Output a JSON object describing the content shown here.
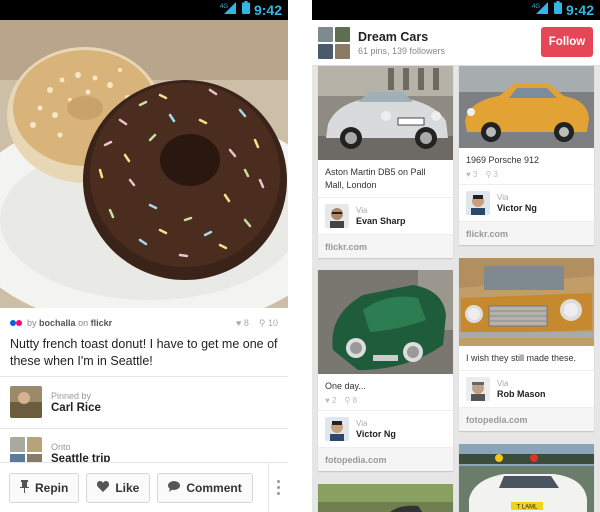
{
  "left": {
    "status": {
      "time": "9:42",
      "network": "4G"
    },
    "pin": {
      "by_prefix": "by",
      "user": "bochalla",
      "on_prefix": "on",
      "source": "flickr",
      "likes": "8",
      "repins": "10",
      "description": "Nutty french toast donut! I have to get me one of these when I'm in Seattle!"
    },
    "pinned_by": {
      "label": "Pinned by",
      "name": "Carl Rice"
    },
    "onto": {
      "label": "Onto",
      "name": "Seattle trip"
    },
    "actions": {
      "repin": "Repin",
      "like": "Like",
      "comment": "Comment"
    }
  },
  "right": {
    "status": {
      "time": "9:42",
      "network": "4G"
    },
    "board": {
      "title": "Dream Cars",
      "stats": "61 pins, 139 followers",
      "follow": "Follow"
    },
    "pins": {
      "aston": {
        "desc": "Aston Martin DB5 on Pall Mall, London",
        "via": "Via",
        "user": "Evan Sharp",
        "source": "flickr.com"
      },
      "porsche": {
        "desc": "1969 Porsche 912",
        "likes": "3",
        "repins": "3",
        "via": "Via",
        "user": "Victor Ng",
        "source": "flickr.com"
      },
      "green": {
        "desc": "One day...",
        "likes": "2",
        "repins": "8",
        "via": "Via",
        "user": "Victor Ng",
        "source": "fotopedia.com"
      },
      "mg": {
        "desc": "I wish they still made these.",
        "via": "Via",
        "user": "Rob Mason",
        "source": "fotopedia.com"
      },
      "white": {
        "plate": "T LAML"
      }
    }
  },
  "colors": {
    "follow": "#e64655",
    "accent": "#33b5e5"
  }
}
